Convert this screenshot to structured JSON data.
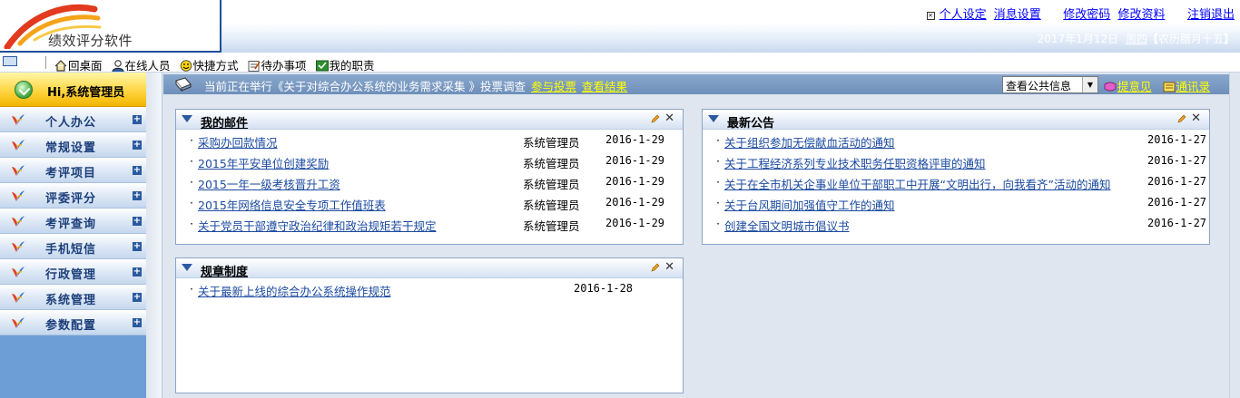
{
  "header": {
    "app_name": "绩效评分软件",
    "links": [
      "个人设定",
      "消息设置",
      "修改密码",
      "修改资料",
      "注销退出"
    ],
    "date": "2017年1月12日",
    "weekday": "周四",
    "lunar": "农历腊月十五"
  },
  "toolbar": {
    "items": [
      {
        "label": "回桌面",
        "icon": "home-icon"
      },
      {
        "label": "在线人员",
        "icon": "online-users-icon"
      },
      {
        "label": "快捷方式",
        "icon": "smiley-icon"
      },
      {
        "label": "待办事项",
        "icon": "todo-icon"
      },
      {
        "label": "我的职责",
        "icon": "duties-icon"
      }
    ]
  },
  "sidebar": {
    "greeting": "Hi,系统管理员",
    "items": [
      {
        "label": "个人办公"
      },
      {
        "label": "常规设置"
      },
      {
        "label": "考评项目"
      },
      {
        "label": "评委评分"
      },
      {
        "label": "考评查询"
      },
      {
        "label": "手机短信"
      },
      {
        "label": "行政管理"
      },
      {
        "label": "系统管理"
      },
      {
        "label": "参数配置"
      }
    ]
  },
  "notice": {
    "text": "当前正在举行《关于对综合办公系统的业务需求采集 》投票调查",
    "vote_label": "参与投票",
    "results_label": "查看结果",
    "select_value": "查看公共信息",
    "feedback_label": "提意见",
    "contacts_label": "通讯录"
  },
  "panels": {
    "mail": {
      "title": "我的邮件",
      "rows": [
        {
          "subject": "采购办回款情况",
          "sender": "系统管理员",
          "date": "2016-1-29"
        },
        {
          "subject": "2015年平安单位创建奖励",
          "sender": "系统管理员",
          "date": "2016-1-29"
        },
        {
          "subject": "2015一年一级考核晋升工资",
          "sender": "系统管理员",
          "date": "2016-1-29"
        },
        {
          "subject": "2015年网络信息安全专项工作值班表",
          "sender": "系统管理员",
          "date": "2016-1-29"
        },
        {
          "subject": "关于党员干部遵守政治纪律和政治规矩若干规定",
          "sender": "系统管理员",
          "date": "2016-1-29"
        }
      ]
    },
    "announcements": {
      "title": "最新公告",
      "rows": [
        {
          "subject": "关于组织参加无偿献血活动的通知",
          "date": "2016-1-27"
        },
        {
          "subject": "关于工程经济系列专业技术职务任职资格评审的通知",
          "date": "2016-1-27"
        },
        {
          "subject": "关于在全市机关企事业单位干部职工中开展“文明出行，向我看齐”活动的通知",
          "date": "2016-1-27"
        },
        {
          "subject": "关于台风期间加强值守工作的通知",
          "date": "2016-1-27"
        },
        {
          "subject": "创建全国文明城市倡议书",
          "date": "2016-1-27"
        }
      ]
    },
    "rules": {
      "title": "规章制度",
      "rows": [
        {
          "subject": "关于最新上线的综合办公系统操作规范",
          "date": "2016-1-28"
        }
      ]
    }
  }
}
